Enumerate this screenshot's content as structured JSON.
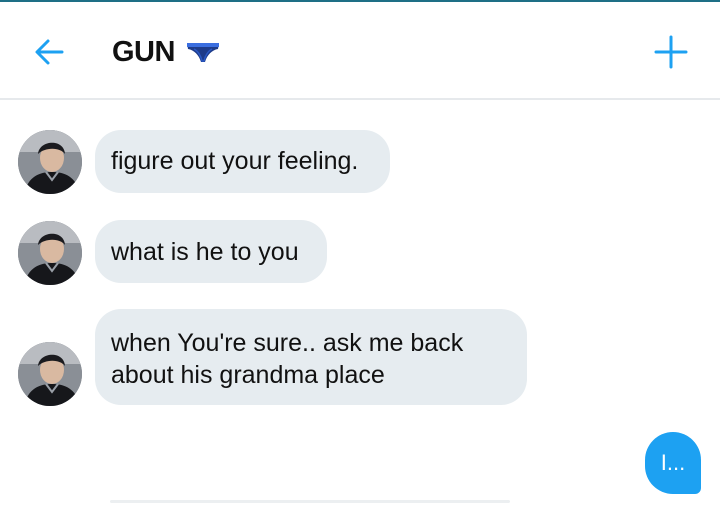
{
  "colors": {
    "accent": "#1da1f2",
    "bubble_other": "#e6ecf0",
    "top_strip": "#1e6f86"
  },
  "header": {
    "title": "GUN",
    "title_emoji": "briefs-icon",
    "back_icon": "arrow-left-icon",
    "add_icon": "plus-icon"
  },
  "messages": [
    {
      "sender": "other",
      "text": "figure out your feeling."
    },
    {
      "sender": "other",
      "text": "what is he to you"
    },
    {
      "sender": "other",
      "lines": [
        "when You're sure.. ask me back",
        "about his grandma place"
      ]
    },
    {
      "sender": "me",
      "text": "I..."
    }
  ]
}
